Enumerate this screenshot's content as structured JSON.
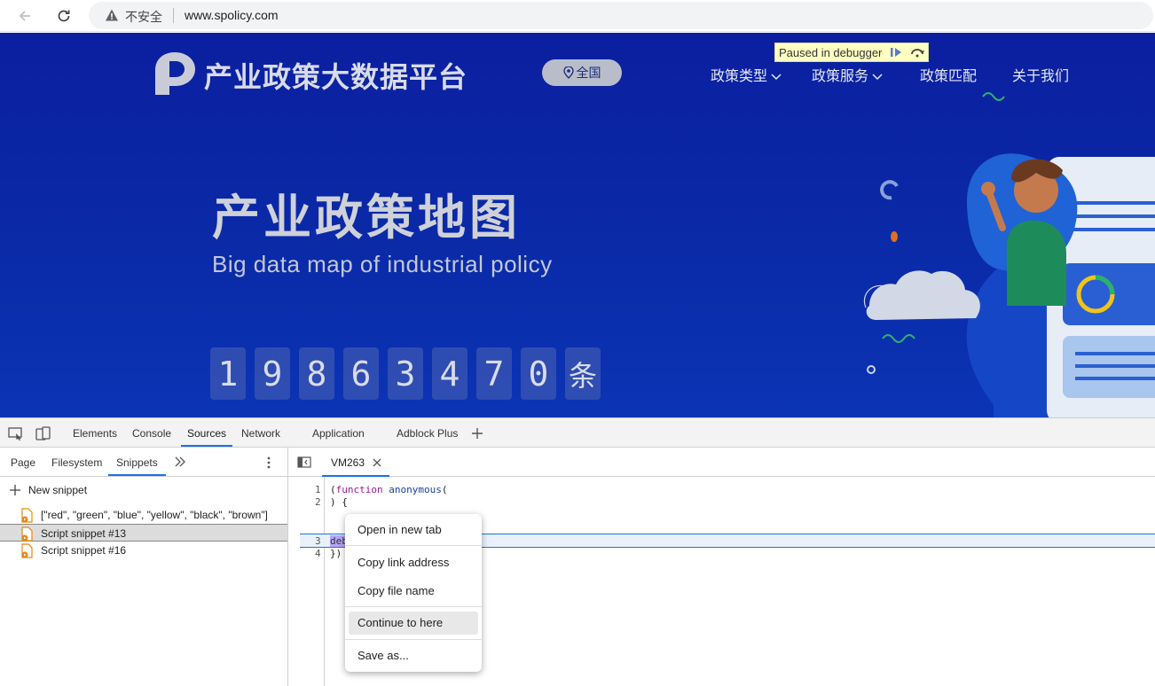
{
  "browser": {
    "security_label": "不安全",
    "url": "www.spolicy.com"
  },
  "site": {
    "logo_text": "产业政策大数据平台",
    "region_label": "全国",
    "nav": [
      {
        "label": "政策类型"
      },
      {
        "label": "政策服务"
      },
      {
        "label": "政策匹配"
      },
      {
        "label": "关于我们"
      }
    ],
    "hero_title": "产业政策地图",
    "hero_subtitle": "Big data map of industrial policy",
    "counter_digits": [
      "1",
      "9",
      "8",
      "6",
      "3",
      "4",
      "7",
      "0"
    ],
    "counter_unit": "条"
  },
  "debugger_overlay": {
    "label": "Paused in debugger"
  },
  "devtools": {
    "tabs": [
      "Elements",
      "Console",
      "Sources",
      "Network",
      "Application",
      "Adblock Plus"
    ],
    "active_tab": "Sources",
    "navigator_tabs": [
      "Page",
      "Filesystem",
      "Snippets"
    ],
    "active_navigator_tab": "Snippets",
    "new_snippet_label": "New snippet",
    "snippets": [
      {
        "label": "[\"red\", \"green\", \"blue\", \"yellow\", \"black\", \"brown\"]"
      },
      {
        "label": "Script snippet #13"
      },
      {
        "label": "Script snippet #16"
      }
    ],
    "editor_tab": "VM263",
    "line_numbers": [
      "1",
      "2",
      "3",
      "4"
    ],
    "code": {
      "l1_kw": "function",
      "l1_fn": "anonymous",
      "l2": ") {",
      "l3": "debugger",
      "l4": "})"
    },
    "context_menu": [
      "Open in new tab",
      "Copy link address",
      "Copy file name",
      "Continue to here",
      "Save as..."
    ]
  },
  "colors": {
    "site_background": "#0b27a6",
    "accent_blue": "#1a73e8",
    "debugger_yellow": "#ffffc2"
  }
}
